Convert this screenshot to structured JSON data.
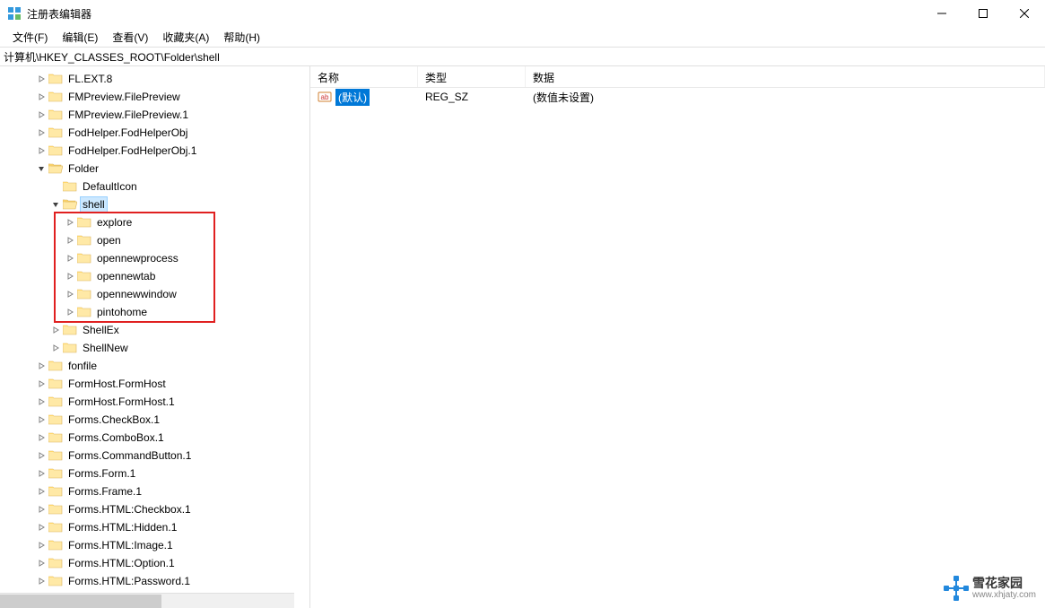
{
  "window": {
    "title": "注册表编辑器"
  },
  "menu": {
    "file": "文件(F)",
    "edit": "编辑(E)",
    "view": "查看(V)",
    "favorites": "收藏夹(A)",
    "help": "帮助(H)"
  },
  "address": {
    "path": "计算机\\HKEY_CLASSES_ROOT\\Folder\\shell"
  },
  "tree": [
    {
      "label": "FL.EXT.8",
      "indent": 2,
      "exp": "closed",
      "open": false
    },
    {
      "label": "FMPreview.FilePreview",
      "indent": 2,
      "exp": "closed",
      "open": false
    },
    {
      "label": "FMPreview.FilePreview.1",
      "indent": 2,
      "exp": "closed",
      "open": false
    },
    {
      "label": "FodHelper.FodHelperObj",
      "indent": 2,
      "exp": "closed",
      "open": false
    },
    {
      "label": "FodHelper.FodHelperObj.1",
      "indent": 2,
      "exp": "closed",
      "open": false
    },
    {
      "label": "Folder",
      "indent": 2,
      "exp": "open",
      "open": true
    },
    {
      "label": "DefaultIcon",
      "indent": 3,
      "exp": "none",
      "open": false
    },
    {
      "label": "shell",
      "indent": 3,
      "exp": "open",
      "open": true,
      "selected": true
    },
    {
      "label": "explore",
      "indent": 4,
      "exp": "closed",
      "open": false,
      "hl": true
    },
    {
      "label": "open",
      "indent": 4,
      "exp": "closed",
      "open": false,
      "hl": true
    },
    {
      "label": "opennewprocess",
      "indent": 4,
      "exp": "closed",
      "open": false,
      "hl": true
    },
    {
      "label": "opennewtab",
      "indent": 4,
      "exp": "closed",
      "open": false,
      "hl": true
    },
    {
      "label": "opennewwindow",
      "indent": 4,
      "exp": "closed",
      "open": false,
      "hl": true
    },
    {
      "label": "pintohome",
      "indent": 4,
      "exp": "closed",
      "open": false,
      "hl": true
    },
    {
      "label": "ShellEx",
      "indent": 3,
      "exp": "closed",
      "open": false
    },
    {
      "label": "ShellNew",
      "indent": 3,
      "exp": "closed",
      "open": false
    },
    {
      "label": "fonfile",
      "indent": 2,
      "exp": "closed",
      "open": false
    },
    {
      "label": "FormHost.FormHost",
      "indent": 2,
      "exp": "closed",
      "open": false
    },
    {
      "label": "FormHost.FormHost.1",
      "indent": 2,
      "exp": "closed",
      "open": false
    },
    {
      "label": "Forms.CheckBox.1",
      "indent": 2,
      "exp": "closed",
      "open": false
    },
    {
      "label": "Forms.ComboBox.1",
      "indent": 2,
      "exp": "closed",
      "open": false
    },
    {
      "label": "Forms.CommandButton.1",
      "indent": 2,
      "exp": "closed",
      "open": false
    },
    {
      "label": "Forms.Form.1",
      "indent": 2,
      "exp": "closed",
      "open": false
    },
    {
      "label": "Forms.Frame.1",
      "indent": 2,
      "exp": "closed",
      "open": false
    },
    {
      "label": "Forms.HTML:Checkbox.1",
      "indent": 2,
      "exp": "closed",
      "open": false
    },
    {
      "label": "Forms.HTML:Hidden.1",
      "indent": 2,
      "exp": "closed",
      "open": false
    },
    {
      "label": "Forms.HTML:Image.1",
      "indent": 2,
      "exp": "closed",
      "open": false
    },
    {
      "label": "Forms.HTML:Option.1",
      "indent": 2,
      "exp": "closed",
      "open": false
    },
    {
      "label": "Forms.HTML:Password.1",
      "indent": 2,
      "exp": "closed",
      "open": false
    }
  ],
  "list": {
    "columns": {
      "name": "名称",
      "type": "类型",
      "data": "数据"
    },
    "rows": [
      {
        "name": "(默认)",
        "type": "REG_SZ",
        "data": "(数值未设置)"
      }
    ]
  },
  "watermark": {
    "main": "雪花家园",
    "sub": "www.xhjaty.com"
  }
}
